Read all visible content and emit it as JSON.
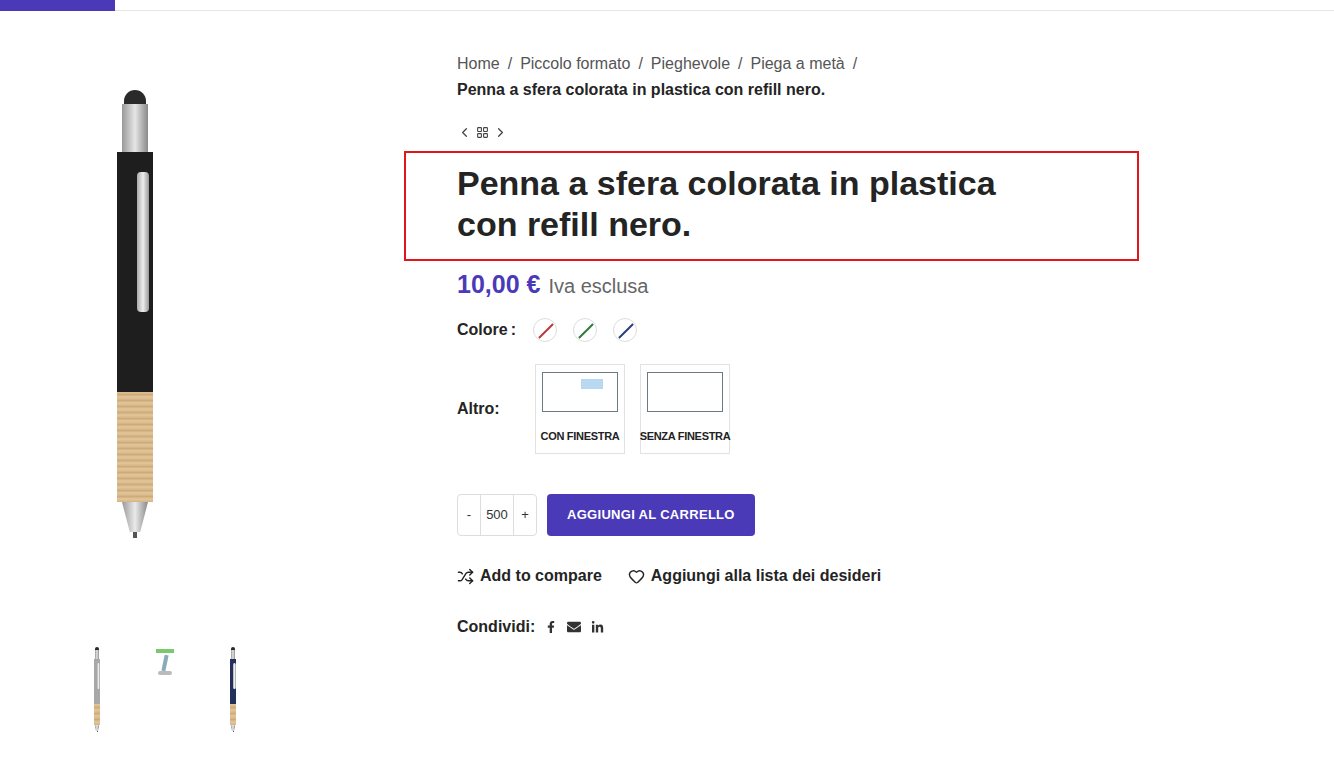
{
  "breadcrumb": {
    "items": [
      "Home",
      "Piccolo formato",
      "Pieghevole",
      "Piega a metà"
    ],
    "separator": "/",
    "current": "Penna a sfera colorata in plastica con refill nero."
  },
  "product": {
    "title": "Penna a sfera colorata in plastica con refill nero.",
    "price": "10,00 €",
    "vat": "Iva esclusa"
  },
  "color_option": {
    "label": "Colore",
    "colon": ":",
    "swatches": [
      {
        "name": "rosso",
        "color": "#b83a3a",
        "selected": false
      },
      {
        "name": "verde",
        "color": "#2f7a3e",
        "selected": false
      },
      {
        "name": "blu",
        "color": "#2a3f7a",
        "selected": false
      }
    ]
  },
  "other_option": {
    "label": "Altro:",
    "choices": [
      {
        "label": "CON FINESTRA",
        "kind": "window",
        "selected": false
      },
      {
        "label": "SENZA FINESTRA",
        "kind": "plain",
        "selected": false
      }
    ]
  },
  "quantity": {
    "minus": "-",
    "value": "500",
    "plus": "+"
  },
  "add_to_cart": "AGGIUNGI AL CARRELLO",
  "actions": [
    "Add to compare",
    "Aggiungi alla lista dei desideri"
  ],
  "share": {
    "label": "Condividi:"
  },
  "thumbnails": [
    {
      "kind": "silver"
    },
    {
      "kind": "stand"
    },
    {
      "kind": "navy"
    }
  ]
}
